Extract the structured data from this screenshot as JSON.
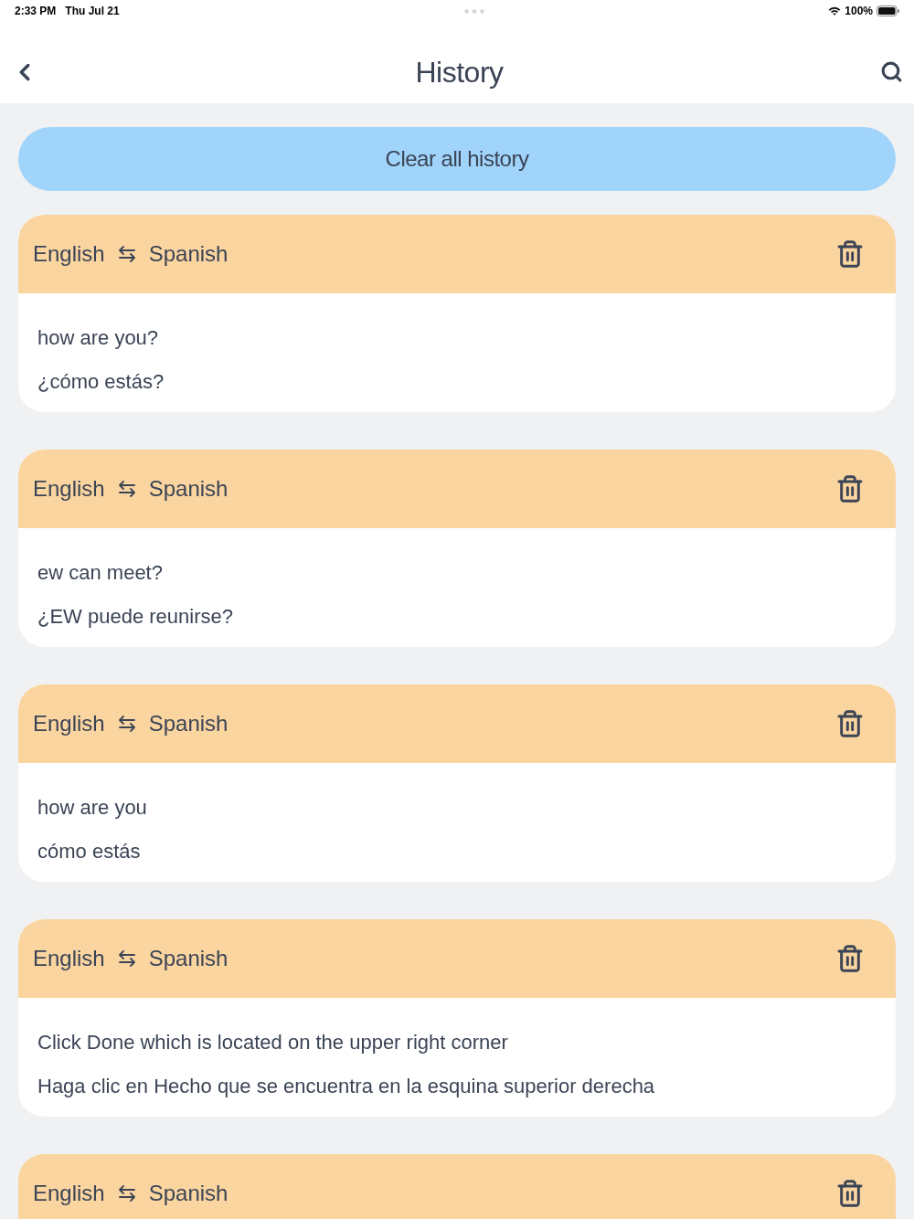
{
  "status_bar": {
    "time": "2:33 PM",
    "date": "Thu Jul 21",
    "battery": "100%"
  },
  "header": {
    "title": "History"
  },
  "clear_button": {
    "label": "Clear all history"
  },
  "history": [
    {
      "source_language": "English",
      "target_language": "Spanish",
      "source_text": "how are you?",
      "translation": "¿cómo estás?"
    },
    {
      "source_language": "English",
      "target_language": "Spanish",
      "source_text": "ew can meet?",
      "translation": "¿EW puede reunirse?"
    },
    {
      "source_language": "English",
      "target_language": "Spanish",
      "source_text": "how are you",
      "translation": "cómo estás"
    },
    {
      "source_language": "English",
      "target_language": "Spanish",
      "source_text": "Click Done which is located on the upper right corner",
      "translation": "Haga clic en Hecho que se encuentra en la esquina superior derecha"
    },
    {
      "source_language": "English",
      "target_language": "Spanish"
    }
  ]
}
